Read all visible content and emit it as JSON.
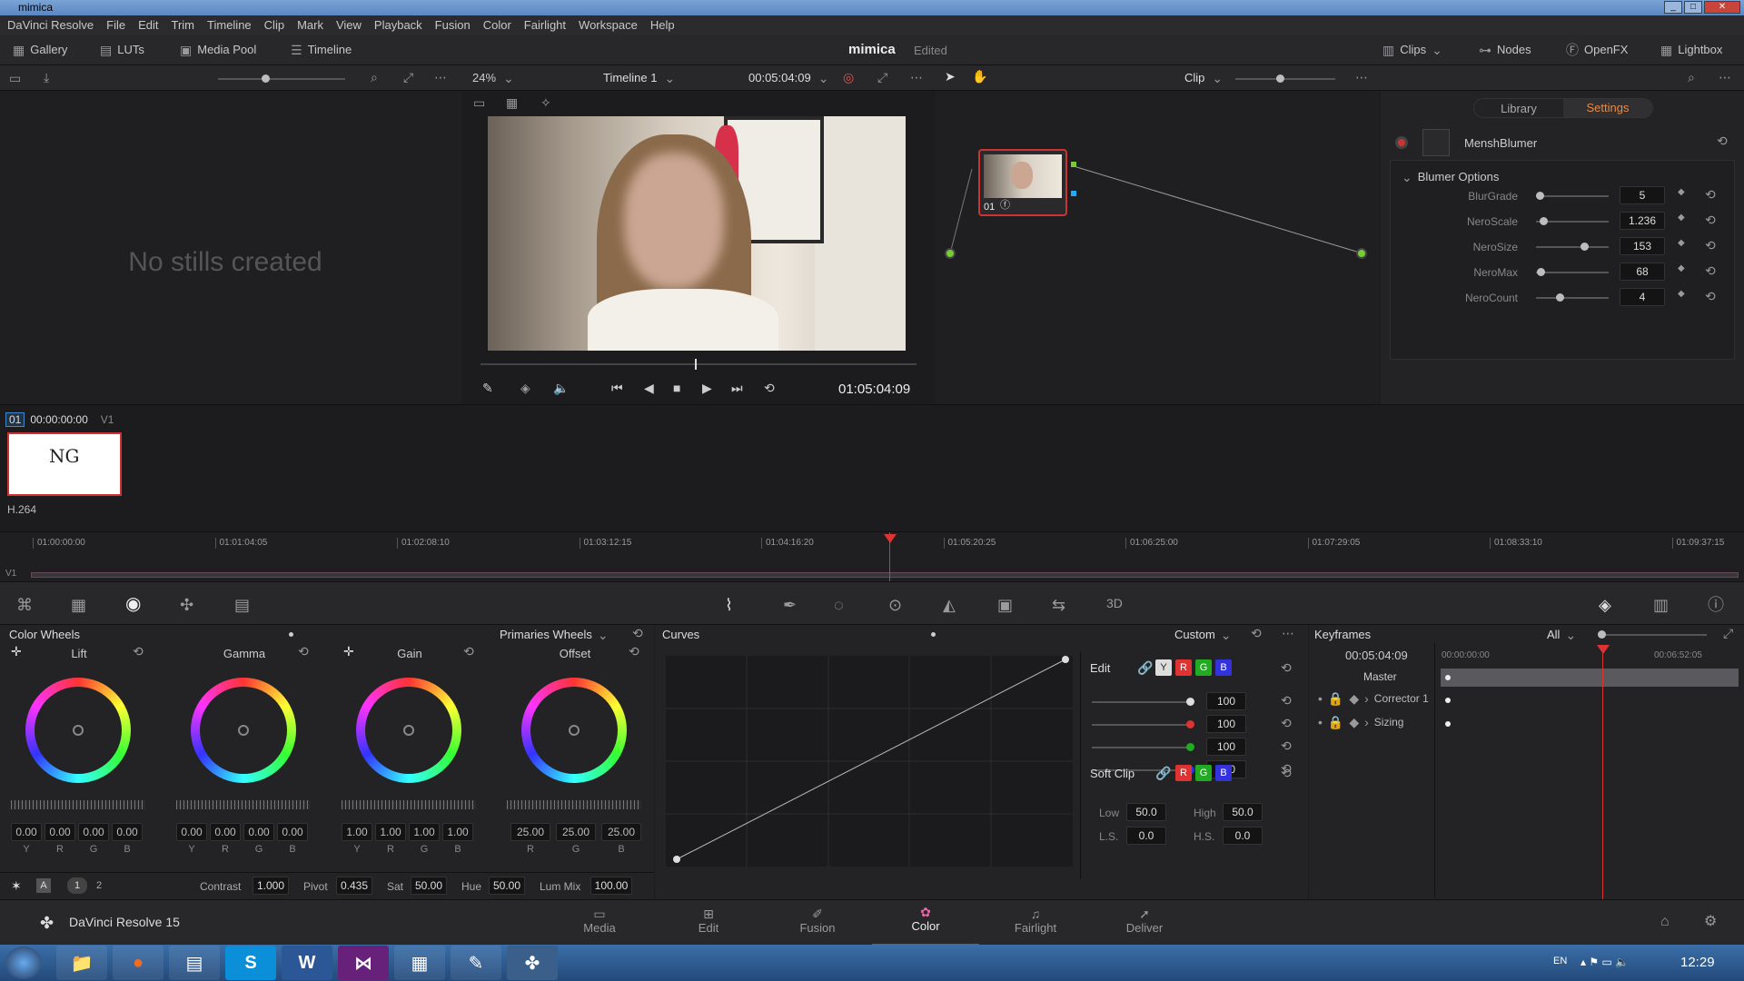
{
  "window": {
    "title": "mimica"
  },
  "menu": [
    "DaVinci Resolve",
    "File",
    "Edit",
    "Trim",
    "Timeline",
    "Clip",
    "Mark",
    "View",
    "Playback",
    "Fusion",
    "Color",
    "Fairlight",
    "Workspace",
    "Help"
  ],
  "toolbar": {
    "gallery": "Gallery",
    "luts": "LUTs",
    "media_pool": "Media Pool",
    "timeline": "Timeline",
    "project": "mimica",
    "status": "Edited",
    "clips": "Clips",
    "nodes": "Nodes",
    "openfx": "OpenFX",
    "lightbox": "Lightbox"
  },
  "viewer": {
    "zoom": "24%",
    "timeline_name": "Timeline 1",
    "timecode_top": "00:05:04:09",
    "timecode": "01:05:04:09",
    "clip_mode": "Clip"
  },
  "gallery": {
    "empty_text": "No stills created"
  },
  "clip": {
    "index": "01",
    "timecode": "00:00:00:00",
    "track": "V1",
    "codec": "H.264",
    "node_label": "01"
  },
  "timeline": {
    "track": "V1",
    "ticks": [
      "01:00:00:00",
      "01:01:04:05",
      "01:02:08:10",
      "01:03:12:15",
      "01:04:16:20",
      "01:05:20:25",
      "01:06:25:00",
      "01:07:29:05",
      "01:08:33:10",
      "01:09:37:15"
    ]
  },
  "openfx": {
    "tab_library": "Library",
    "tab_settings": "Settings",
    "plugin": "MenshBlumer",
    "group": "Blumer Options",
    "params": [
      {
        "label": "BlurGrade",
        "value": "5",
        "pos": 0.0
      },
      {
        "label": "NeroScale",
        "value": "1.236",
        "pos": 0.05
      },
      {
        "label": "NeroSize",
        "value": "153",
        "pos": 0.68
      },
      {
        "label": "NeroMax",
        "value": "68",
        "pos": 0.02
      },
      {
        "label": "NeroCount",
        "value": "4",
        "pos": 0.3
      }
    ]
  },
  "wheels": {
    "title": "Color Wheels",
    "mode": "Primaries Wheels",
    "items": [
      {
        "name": "Lift",
        "vals": [
          "0.00",
          "0.00",
          "0.00",
          "0.00"
        ],
        "labels": [
          "Y",
          "R",
          "G",
          "B"
        ]
      },
      {
        "name": "Gamma",
        "vals": [
          "0.00",
          "0.00",
          "0.00",
          "0.00"
        ],
        "labels": [
          "Y",
          "R",
          "G",
          "B"
        ]
      },
      {
        "name": "Gain",
        "vals": [
          "1.00",
          "1.00",
          "1.00",
          "1.00"
        ],
        "labels": [
          "Y",
          "R",
          "G",
          "B"
        ]
      },
      {
        "name": "Offset",
        "vals": [
          "25.00",
          "25.00",
          "25.00"
        ],
        "labels": [
          "R",
          "G",
          "B"
        ]
      }
    ],
    "page1": "1",
    "page2": "2",
    "contrast_label": "Contrast",
    "contrast": "1.000",
    "pivot_label": "Pivot",
    "pivot": "0.435",
    "sat_label": "Sat",
    "sat": "50.00",
    "hue_label": "Hue",
    "hue": "50.00",
    "lummix_label": "Lum Mix",
    "lummix": "100.00"
  },
  "curves": {
    "title": "Curves",
    "mode": "Custom",
    "edit": "Edit",
    "y": "Y",
    "r": "R",
    "g": "G",
    "b": "B",
    "intensity": [
      "100",
      "100",
      "100",
      "100"
    ],
    "softclip": "Soft Clip",
    "low_label": "Low",
    "low": "50.0",
    "high_label": "High",
    "high": "50.0",
    "ls_label": "L.S.",
    "ls": "0.0",
    "hs_label": "H.S.",
    "hs": "0.0"
  },
  "keyframes": {
    "title": "Keyframes",
    "filter": "All",
    "timecode": "00:05:04:09",
    "tc_start": "00:00:00:00",
    "tc_end": "00:06:52:05",
    "rows": [
      "Master",
      "Corrector 1",
      "Sizing"
    ]
  },
  "pages": {
    "app": "DaVinci Resolve 15",
    "media": "Media",
    "edit": "Edit",
    "fusion": "Fusion",
    "color": "Color",
    "fairlight": "Fairlight",
    "deliver": "Deliver"
  },
  "taskbar": {
    "lang": "EN",
    "time": "12:29",
    "apps": [
      "explorer-icon",
      "firefox-icon",
      "save-icon",
      "skype-icon",
      "word-icon",
      "visual-studio-icon",
      "film-icon",
      "paint-icon",
      "davinci-icon"
    ]
  }
}
